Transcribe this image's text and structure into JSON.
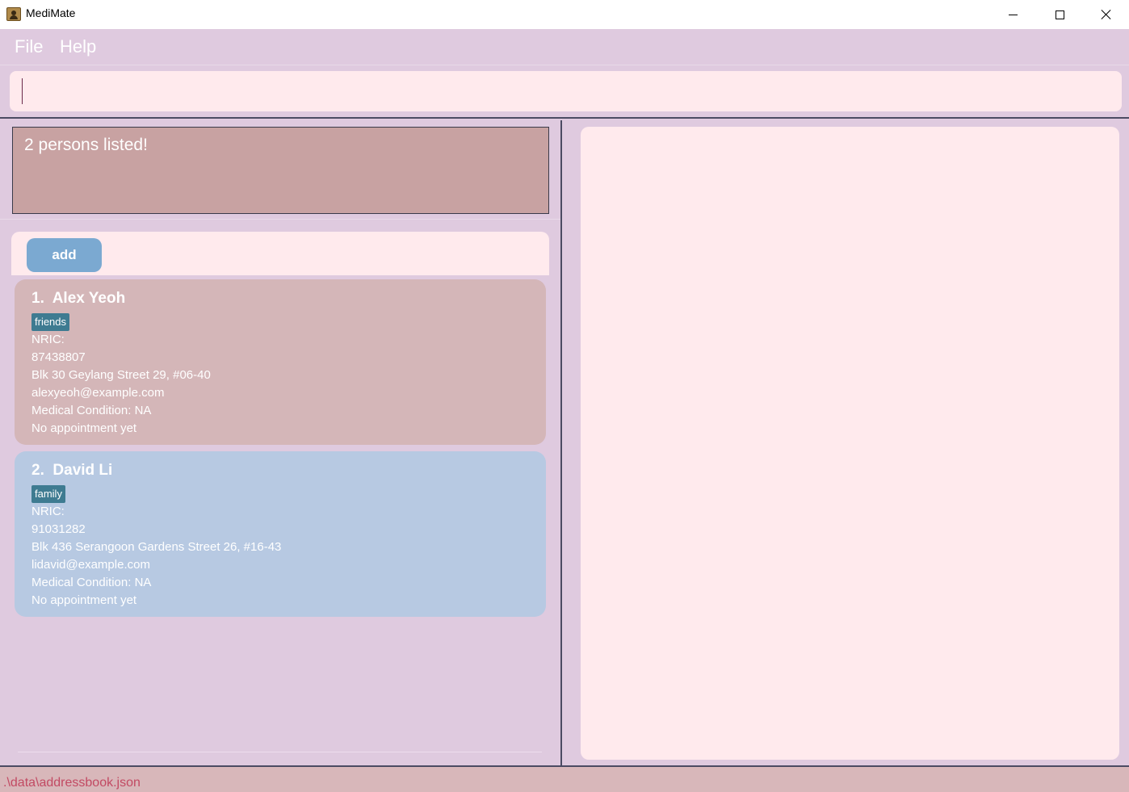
{
  "window": {
    "title": "MediMate",
    "controls": [
      "minimize-icon",
      "maximize-icon",
      "close-icon"
    ]
  },
  "menu": {
    "file": "File",
    "help": "Help"
  },
  "command": {
    "value": "",
    "placeholder": ""
  },
  "result": {
    "message": "2 persons listed!"
  },
  "list": {
    "add_label": "add",
    "persons": [
      {
        "name": "1.  Alex Yeoh",
        "tag": "friends",
        "nric": "NRIC:",
        "phone": "87438807",
        "address": "Blk 30 Geylang Street 29, #06-40",
        "email": "alexyeoh@example.com",
        "condition": "Medical Condition: NA",
        "appointment": "No appointment yet"
      },
      {
        "name": "2.  David Li",
        "tag": "family",
        "nric": "NRIC:",
        "phone": "91031282",
        "address": "Blk 436 Serangoon Gardens Street 26, #16-43",
        "email": "lidavid@example.com",
        "condition": "Medical Condition: NA",
        "appointment": "No appointment yet"
      }
    ]
  },
  "status": {
    "path": ".\\data\\addressbook.json"
  },
  "colors": {
    "background": "#dfcadf",
    "command_bg": "#ffeaed",
    "result_bg": "#c8a2a2",
    "card_1_bg": "#d4b6b8",
    "card_2_bg": "#b7c9e2",
    "tag_bg": "#3e7b91",
    "add_button_bg": "#7ba9d1",
    "status_bg": "#d8b7ba",
    "status_text": "#c24a63"
  }
}
